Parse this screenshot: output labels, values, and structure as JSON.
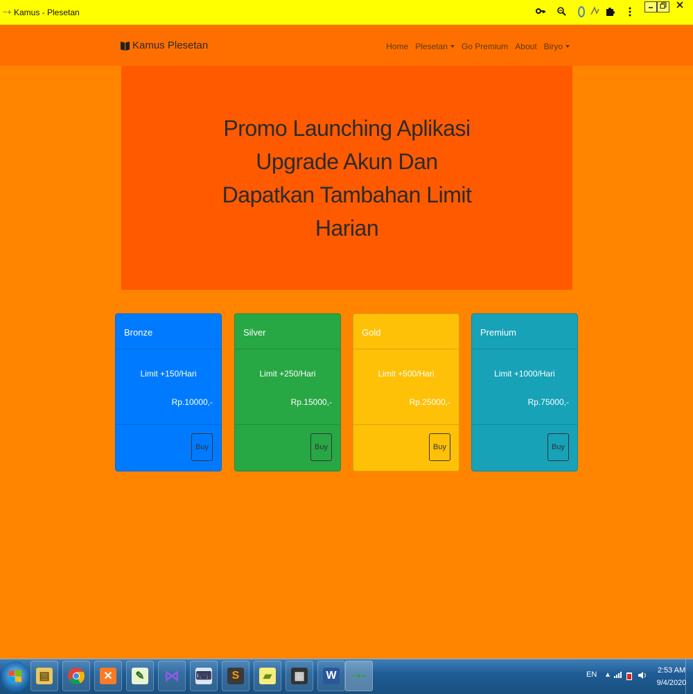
{
  "window": {
    "title": "Kamus - Plesetan",
    "toolbar_icons": [
      "key-icon",
      "zoom-icon",
      "extension-icon",
      "translate-icon",
      "puzzle-icon",
      "more-vert-icon"
    ],
    "controls": [
      "minimize-icon",
      "restore-icon",
      "close-icon"
    ]
  },
  "navbar": {
    "brand": "Kamus Plesetan",
    "links": [
      {
        "label": "Home",
        "dropdown": false
      },
      {
        "label": "Plesetan",
        "dropdown": true
      },
      {
        "label": "Go Premium",
        "dropdown": false
      },
      {
        "label": "About",
        "dropdown": false
      },
      {
        "label": "Biryo",
        "dropdown": true
      }
    ]
  },
  "hero": {
    "title": "Promo Launching Aplikasi Upgrade Akun Dan Dapatkan Tambahan Limit Harian"
  },
  "cards": [
    {
      "name": "Bronze",
      "limit": "Limit +150/Hari",
      "price": "Rp.10000,-",
      "button": "Buy",
      "color": "#007bff"
    },
    {
      "name": "Silver",
      "limit": "Limit +250/Hari",
      "price": "Rp.15000,-",
      "button": "Buy",
      "color": "#28a745"
    },
    {
      "name": "Gold",
      "limit": "Limit +500/Hari",
      "price": "Rp.25000,-",
      "button": "Buy",
      "color": "#ffc107"
    },
    {
      "name": "Premium",
      "limit": "Limit +1000/Hari",
      "price": "Rp.75000,-",
      "button": "Buy",
      "color": "#17a2b8"
    }
  ],
  "taskbar": {
    "apps": [
      "file-manager-icon",
      "chrome-icon",
      "xampp-icon",
      "notepadpp-icon",
      "visual-studio-icon",
      "keyboard-icon",
      "sublime-icon",
      "sticky-notes-icon",
      "film-icon",
      "word-icon",
      "browser-window-icon"
    ],
    "tray": {
      "language": "EN",
      "time": "2:53 AM",
      "date": "9/4/2020"
    }
  },
  "colors": {
    "page_background": "#ff8400",
    "navbar": "#ff6f00",
    "hero": "#ff5a00",
    "titlebar": "#ffff00"
  }
}
